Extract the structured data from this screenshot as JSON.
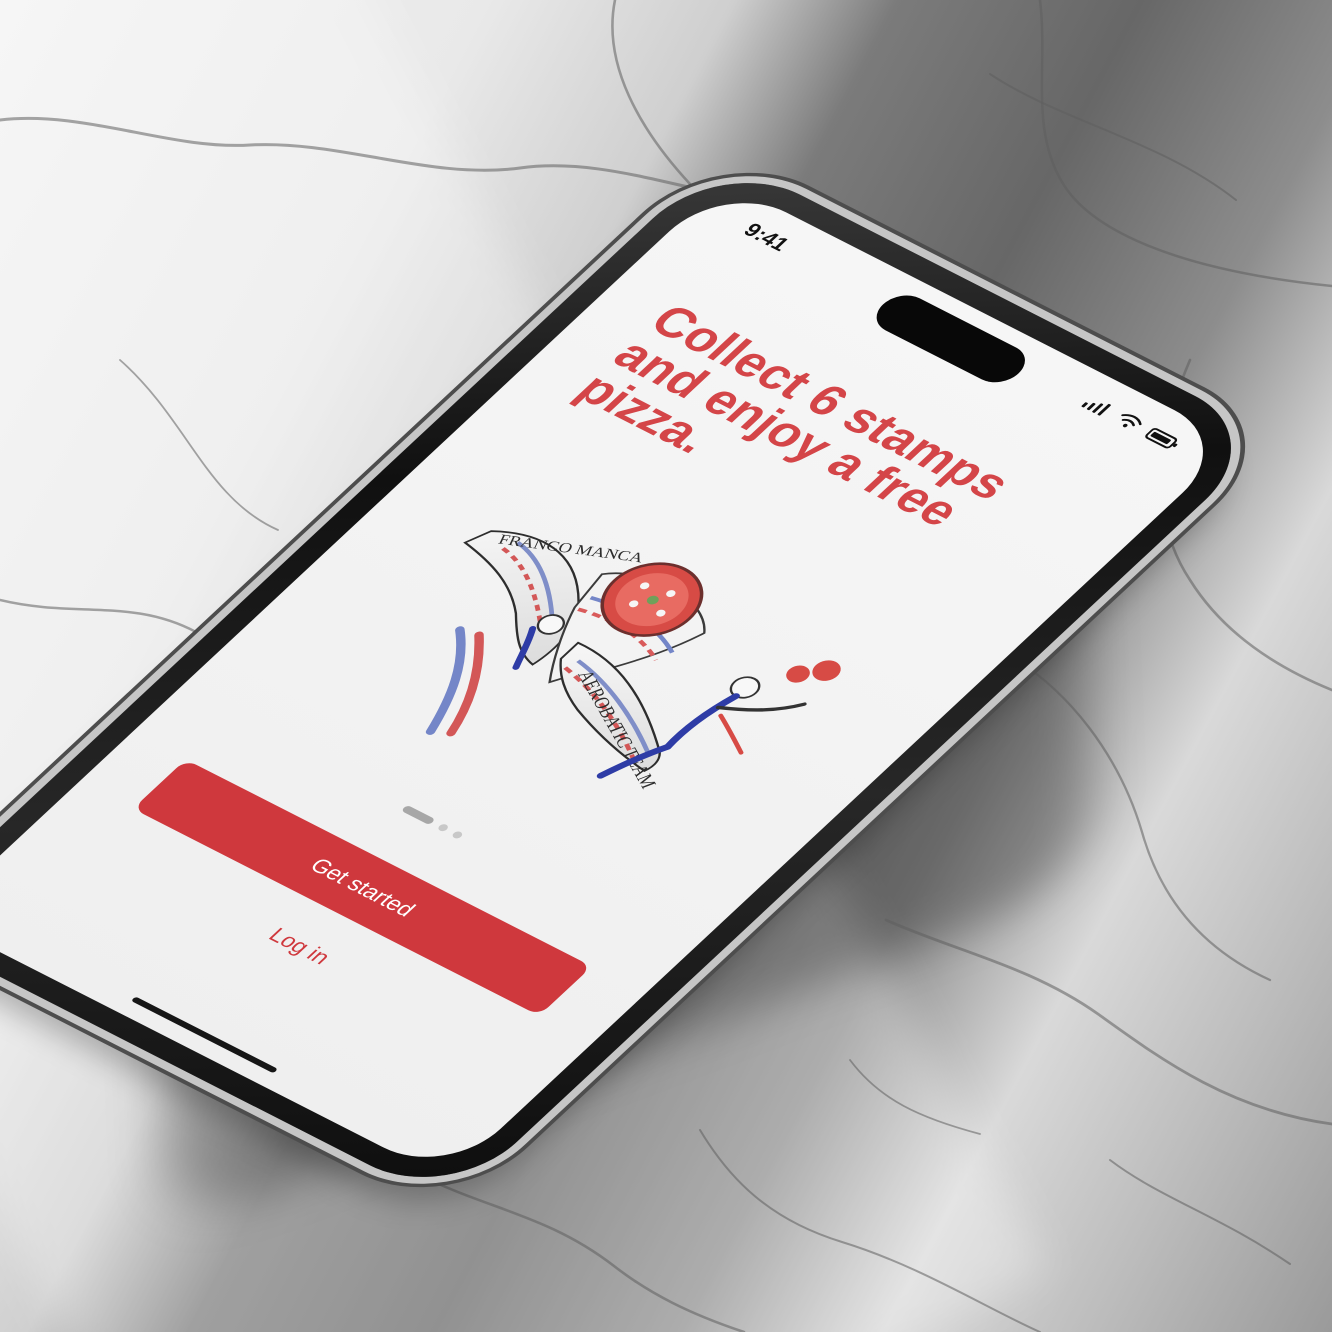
{
  "status": {
    "time": "9:41",
    "icons": [
      "signal-icon",
      "wifi-icon",
      "battery-icon"
    ]
  },
  "onboarding": {
    "headline": "Collect 6 stamps and enjoy a free pizza.",
    "art_labels": {
      "left_wing": "FRANCO MANCA",
      "banner": "AEROBATIC TEAM"
    },
    "pager": {
      "current_page": 1,
      "total_pages": 3
    },
    "get_started_label": "Get started",
    "login_label": "Log in"
  },
  "colors": {
    "brand_red": "#cf383d",
    "headline_red": "#d44548",
    "screen_bg": "#f3f3f3",
    "dark_text": "#111111"
  }
}
